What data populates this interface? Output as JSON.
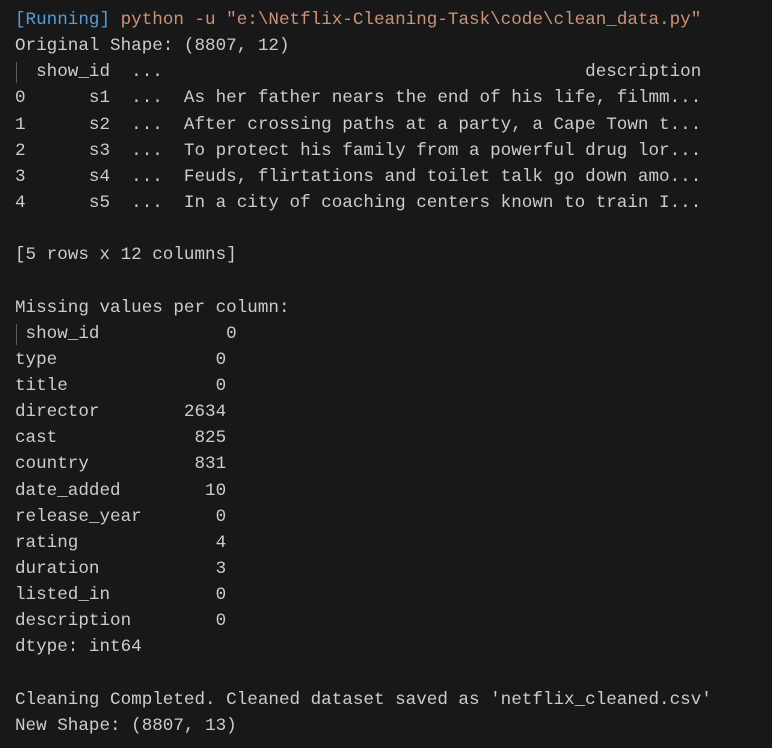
{
  "output_panel": {
    "running_tag": "[Running]",
    "command": "python -u \"e:\\Netflix-Cleaning-Task\\code\\clean_data.py\"",
    "original_shape": "Original Shape: (8807, 12)",
    "preview": {
      "columns": [
        "show_id",
        "...",
        "description"
      ],
      "rows": [
        {
          "index": "0",
          "show_id": "s1",
          "ellipsis": "...",
          "description": "As her father nears the end of his life, filmm..."
        },
        {
          "index": "1",
          "show_id": "s2",
          "ellipsis": "...",
          "description": "After crossing paths at a party, a Cape Town t..."
        },
        {
          "index": "2",
          "show_id": "s3",
          "ellipsis": "...",
          "description": "To protect his family from a powerful drug lor..."
        },
        {
          "index": "3",
          "show_id": "s4",
          "ellipsis": "...",
          "description": "Feuds, flirtations and toilet talk go down amo..."
        },
        {
          "index": "4",
          "show_id": "s5",
          "ellipsis": "...",
          "description": "In a city of coaching centers known to train I..."
        }
      ],
      "summary": "[5 rows x 12 columns]"
    },
    "missing_header": "Missing values per column:",
    "missing": [
      {
        "column": "show_id",
        "count": "0"
      },
      {
        "column": "type",
        "count": "0"
      },
      {
        "column": "title",
        "count": "0"
      },
      {
        "column": "director",
        "count": "2634"
      },
      {
        "column": "cast",
        "count": "825"
      },
      {
        "column": "country",
        "count": "831"
      },
      {
        "column": "date_added",
        "count": "10"
      },
      {
        "column": "release_year",
        "count": "0"
      },
      {
        "column": "rating",
        "count": "4"
      },
      {
        "column": "duration",
        "count": "3"
      },
      {
        "column": "listed_in",
        "count": "0"
      },
      {
        "column": "description",
        "count": "0"
      }
    ],
    "dtype": "dtype: int64",
    "completed": "Cleaning Completed. Cleaned dataset saved as 'netflix_cleaned.csv'",
    "new_shape": "New Shape: (8807, 13)"
  }
}
